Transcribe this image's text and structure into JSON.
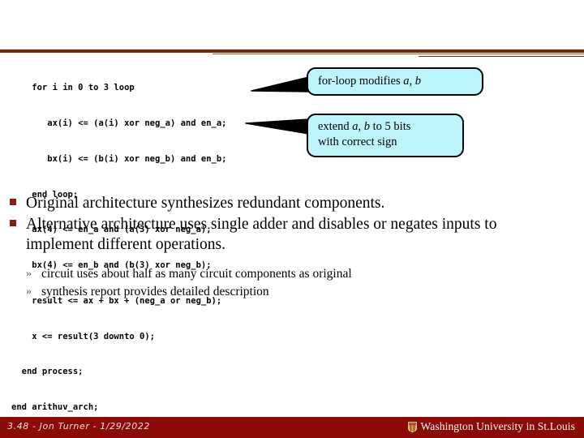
{
  "slide": {
    "code_lines": [
      "    for i in 0 to 3 loop",
      "       ax(i) <= (a(i) xor neg_a) and en_a;",
      "       bx(i) <= (b(i) xor neg_b) and en_b;",
      "    end loop;",
      "    ax(4) <= en_a and (a(3) xor neg_a);",
      "    bx(4) <= en_b and (b(3) xor neg_b);",
      "    result <= ax + bx + (neg_a or neg_b);",
      "    x <= result(3 downto 0);",
      "  end process;",
      "end arithuv_arch;"
    ],
    "callouts": [
      {
        "name": "for-loop-callout",
        "prefix": "for-loop modifies ",
        "var1": "a",
        "sep": ", ",
        "var2": "b",
        "suffix": ""
      },
      {
        "name": "sign-extend-callout",
        "prefix": "extend ",
        "var1": "a",
        "sep": ", ",
        "var2": "b",
        "suffix": " to 5 bits",
        "line2": "with correct sign"
      }
    ],
    "bullets": [
      {
        "marker": "square",
        "text": "Original architecture synthesizes redundant components."
      },
      {
        "marker": "square",
        "text": "Alternative architecture uses single adder and disables or negates inputs to implement different operations."
      }
    ],
    "subbullets": [
      {
        "marker": "»",
        "text": "circuit uses about half as many circuit components as original"
      },
      {
        "marker": "»",
        "text": "synthesis report provides detailed description"
      }
    ],
    "footer": {
      "left": "3.48 - Jon Turner - 1/29/2022",
      "university": "Washington University in St.Louis",
      "crest_icon": "shield-crest-icon"
    },
    "colors": {
      "accent_dark_red": "#7B2504",
      "footer_red": "#8B0A06",
      "callout_fill": "#BDF5FC",
      "bullet_square": "#8B1A10",
      "subbullet_green": "#3F6B44"
    }
  }
}
